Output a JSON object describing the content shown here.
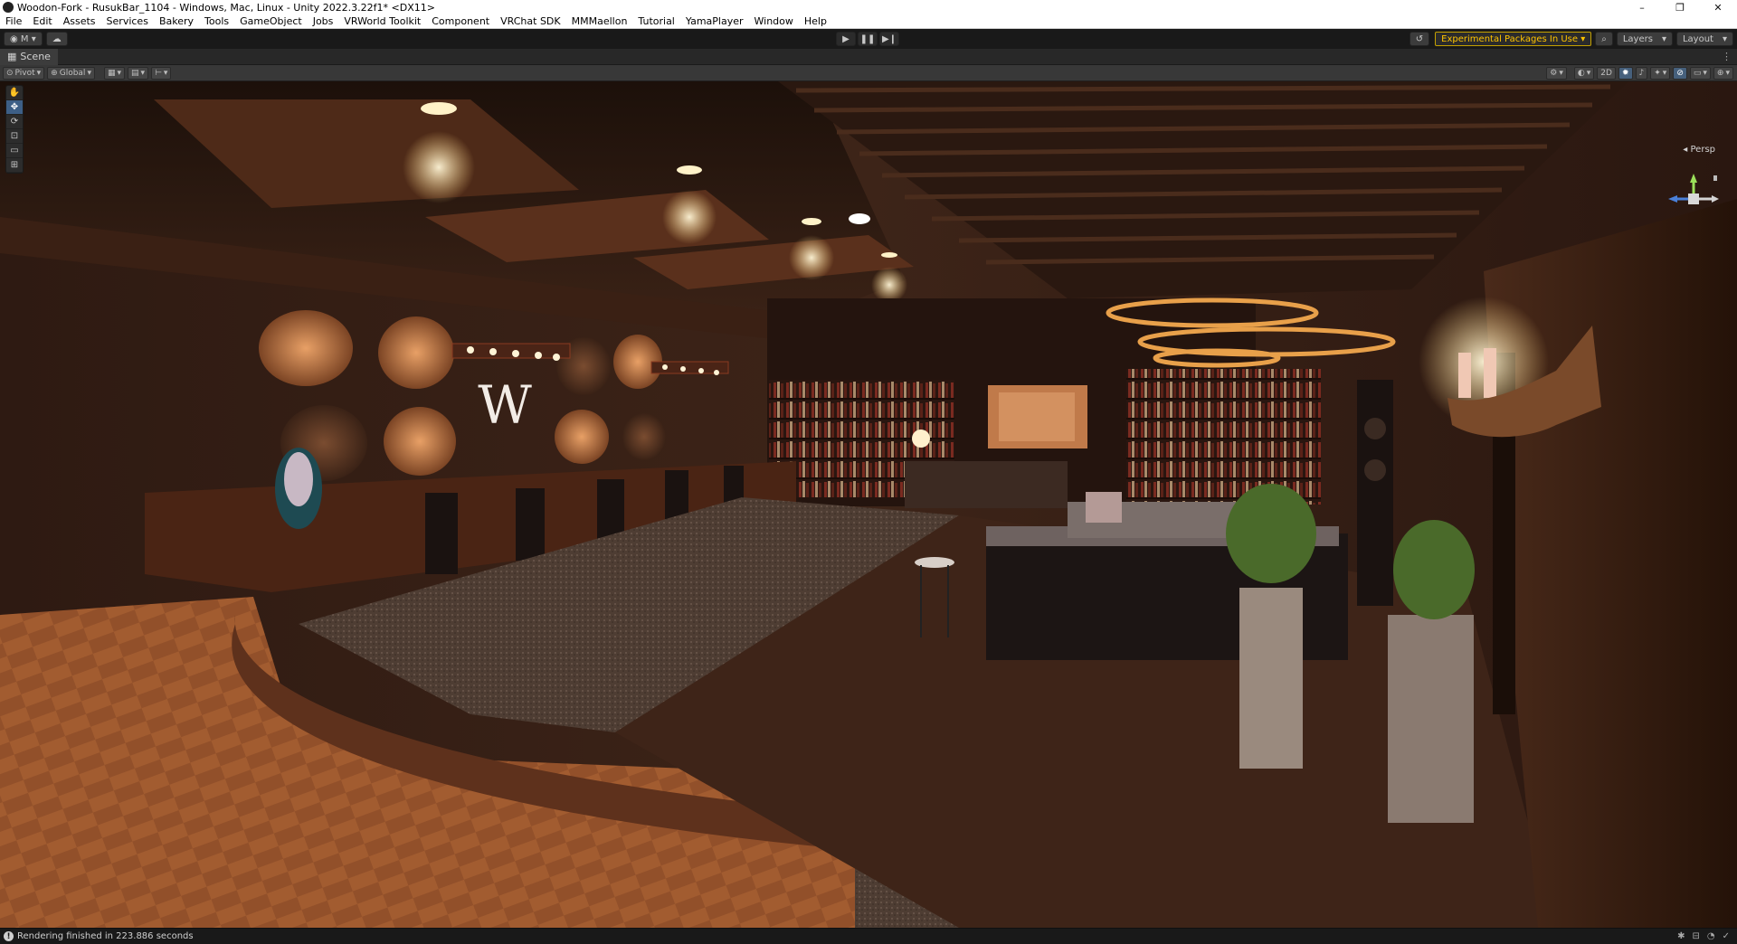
{
  "window": {
    "title": "Woodon-Fork - RusukBar_1104 - Windows, Mac, Linux - Unity 2022.3.22f1* <DX11>",
    "controls": [
      "–",
      "❐",
      "✕"
    ]
  },
  "menu": {
    "items": [
      "File",
      "Edit",
      "Assets",
      "Services",
      "Bakery",
      "Tools",
      "GameObject",
      "Jobs",
      "VRWorld Toolkit",
      "Component",
      "VRChat SDK",
      "MMMaellon",
      "Tutorial",
      "YamaPlayer",
      "Window",
      "Help"
    ]
  },
  "toolbar": {
    "account_label": "M",
    "play": "▶",
    "pause": "❚❚",
    "step": "▶❙",
    "experimental_label": "Experimental Packages In Use",
    "layers_label": "Layers",
    "layout_label": "Layout"
  },
  "tab": {
    "scene_label": "Scene"
  },
  "scene_toolbar": {
    "pivot_label": "Pivot",
    "global_label": "Global",
    "mode_2d_label": "2D"
  },
  "viewport": {
    "wall_logo": "W",
    "projection_label": "Persp",
    "gizmo_axes": [
      "x",
      "y",
      "z"
    ]
  },
  "status": {
    "message": "Rendering finished in 223.886 seconds"
  },
  "colors": {
    "accent": "#ffc400",
    "active_tool": "#3d5f86",
    "wood": "#6b3a22",
    "floor": "#8a4a26"
  }
}
